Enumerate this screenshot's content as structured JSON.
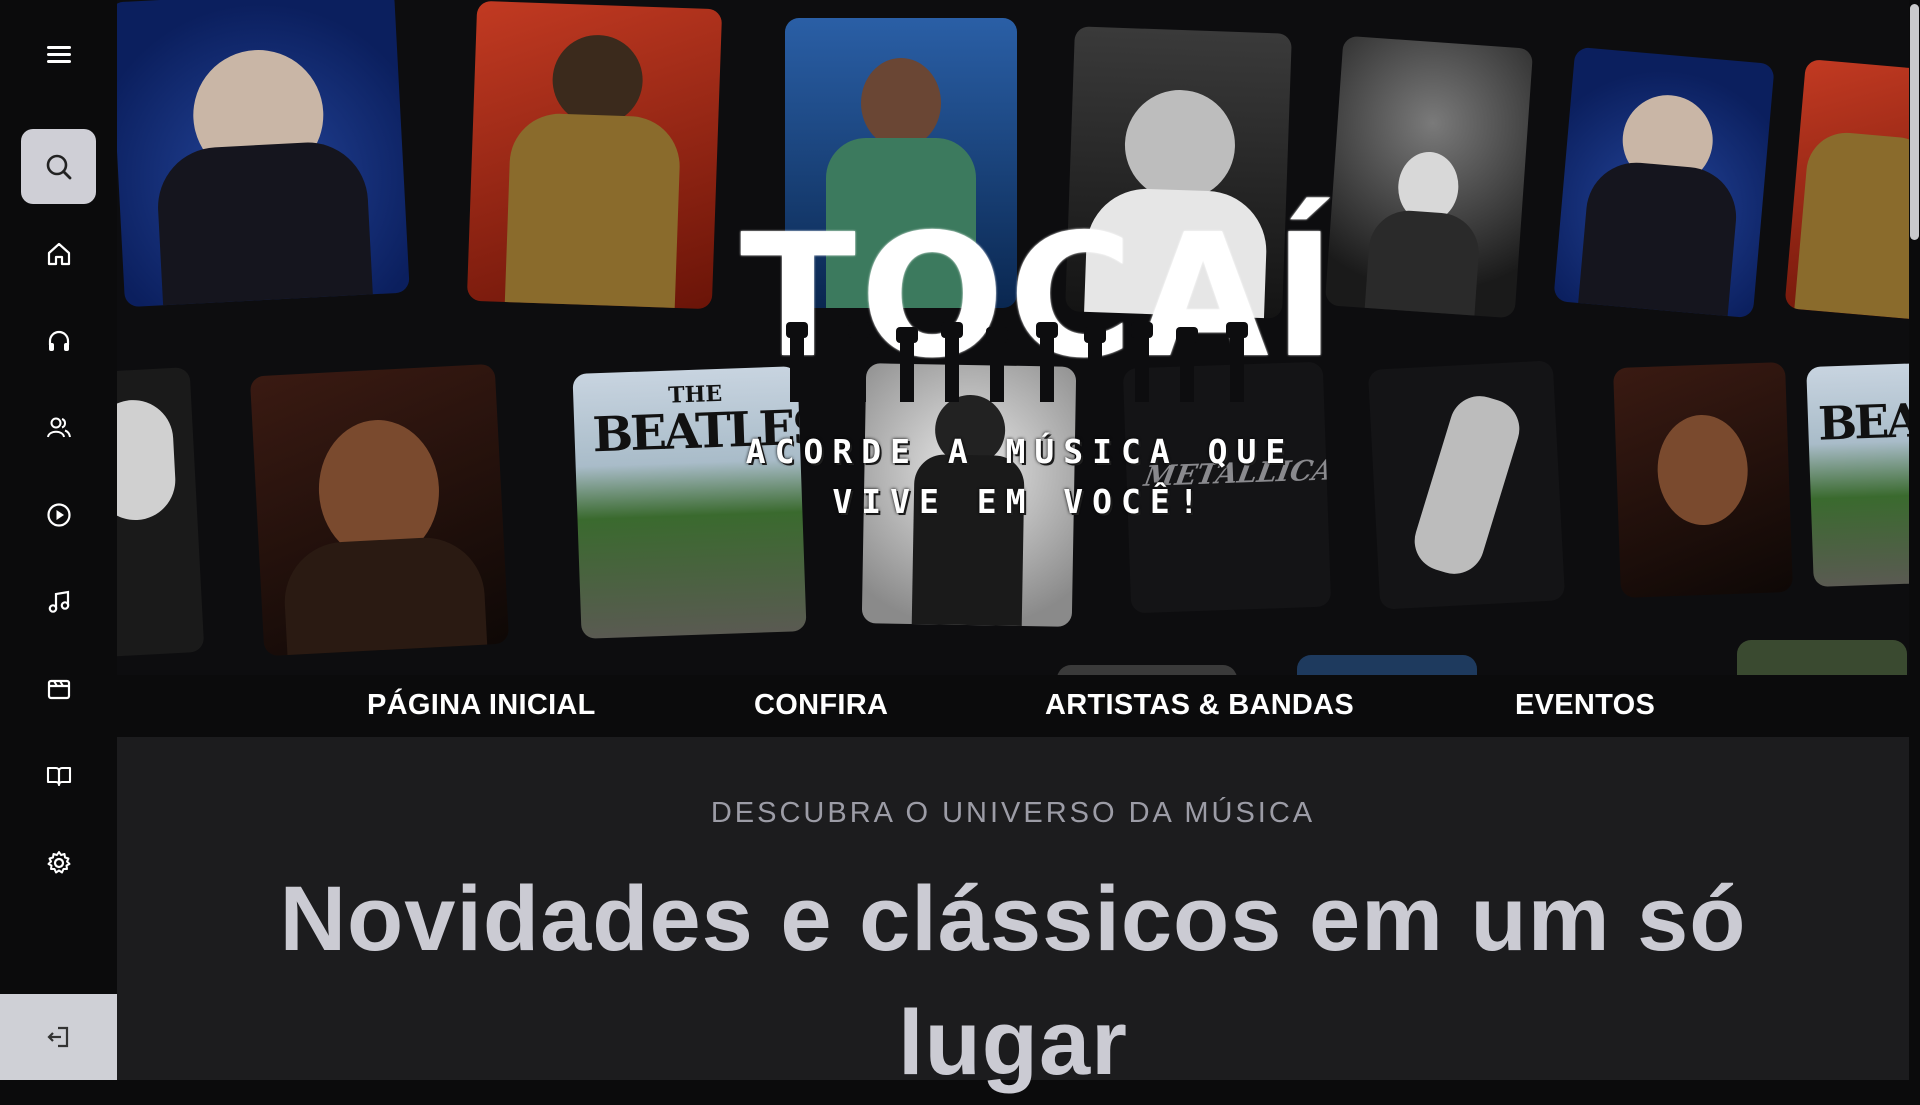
{
  "sidebar": {
    "menu_icon": "hamburger-menu-icon",
    "items": [
      {
        "name": "search",
        "icon": "search-icon",
        "active": true
      },
      {
        "name": "home",
        "icon": "home-icon"
      },
      {
        "name": "headphones",
        "icon": "headphones-icon"
      },
      {
        "name": "artists",
        "icon": "users-icon"
      },
      {
        "name": "play",
        "icon": "play-circle-icon"
      },
      {
        "name": "music",
        "icon": "music-note-icon"
      },
      {
        "name": "video",
        "icon": "clapperboard-icon"
      },
      {
        "name": "library",
        "icon": "book-open-icon"
      },
      {
        "name": "settings",
        "icon": "gear-icon"
      }
    ],
    "logout_icon": "logout-icon"
  },
  "hero": {
    "logo_text": "TOCAÍ",
    "tagline_line1": "ACORDE A MÚSICA QUE",
    "tagline_line2": "VIVE EM VOCÊ!",
    "tile_text_beatles_the": "THE",
    "tile_text_beatles": "BEATLES",
    "tile_text_metallica": "METALLICA",
    "tile_text_beatles_partial": "BEA"
  },
  "nav": {
    "items": [
      "PÁGINA INICIAL",
      "CONFIRA",
      "ARTISTAS & BANDAS",
      "EVENTOS"
    ]
  },
  "content": {
    "eyebrow": "DESCUBRA O UNIVERSO DA MÚSICA",
    "headline": "Novidades e clássicos em um só lugar"
  },
  "colors": {
    "background": "#0b0b0c",
    "content_bg": "#1c1c1e",
    "active_button": "#cfcfd6",
    "headline": "#cbcbd3",
    "eyebrow": "#9c9ca6"
  }
}
